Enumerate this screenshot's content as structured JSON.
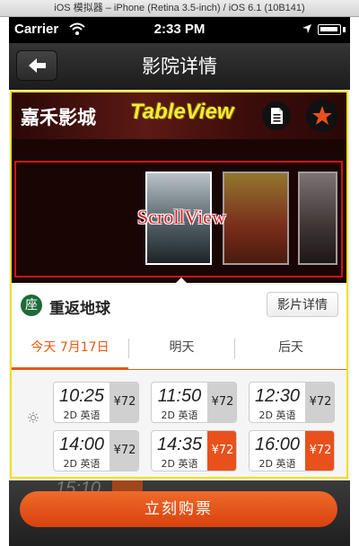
{
  "simulator": {
    "title": "iOS 模拟器 – iPhone (Retina 3.5-inch) / iOS 6.1 (10B141)"
  },
  "status_bar": {
    "carrier": "Carrier",
    "time": "2:33 PM"
  },
  "nav": {
    "title": "影院详情",
    "back_icon": "back-arrow-icon"
  },
  "header": {
    "cinema_name": "嘉禾影城",
    "annotation": "TableView",
    "doc_icon": "document-icon",
    "star_icon": "star-icon",
    "star_color": "#e8511c"
  },
  "scroll": {
    "annotation": "ScrollView"
  },
  "movie": {
    "seat_badge": "座",
    "title": "重返地球",
    "detail_button": "影片详情"
  },
  "tabs": [
    {
      "label": "今天 7月17日",
      "active": true
    },
    {
      "label": "明天",
      "active": false
    },
    {
      "label": "后天",
      "active": false
    }
  ],
  "showtimes": [
    {
      "time": "10:25",
      "format": "2D 英语",
      "price": "¥72",
      "highlight": false
    },
    {
      "time": "11:50",
      "format": "2D 英语",
      "price": "¥72",
      "highlight": false
    },
    {
      "time": "12:30",
      "format": "2D 英语",
      "price": "¥72",
      "highlight": false
    },
    {
      "time": "14:00",
      "format": "2D 英语",
      "price": "¥72",
      "highlight": false
    },
    {
      "time": "14:35",
      "format": "2D 英语",
      "price": "¥72",
      "highlight": true
    },
    {
      "time": "16:00",
      "format": "2D 英语",
      "price": "¥72",
      "highlight": true
    }
  ],
  "bottom": {
    "buy_button": "立刻购票",
    "ghost_time": "15:10"
  },
  "colors": {
    "accent": "#e8511c",
    "annotation_yellow": "#f0e020",
    "annotation_red": "#d3121a"
  }
}
